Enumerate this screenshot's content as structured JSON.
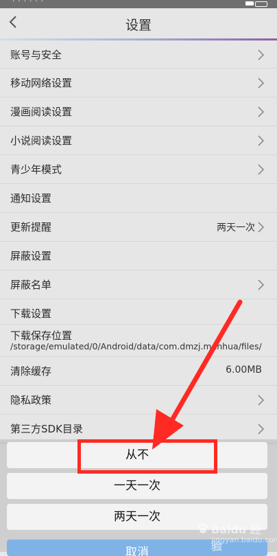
{
  "header": {
    "title": "设置"
  },
  "settings": {
    "account_security": "账号与安全",
    "mobile_network": "移动网络设置",
    "comic_reading": "漫画阅读设置",
    "novel_reading": "小说阅读设置",
    "teen_mode": "青少年模式",
    "notifications": "通知设置",
    "update_reminder": "更新提醒",
    "update_reminder_value": "两天一次",
    "block_settings": "屏蔽设置",
    "block_list": "屏蔽名单",
    "download_settings": "下载设置",
    "download_location": "下载保存位置",
    "download_path": "/storage/emulated/0/Android/data/com.dmzj.manhua/files/",
    "clear_cache": "清除缓存",
    "cache_size": "6.00MB",
    "privacy_policy": "隐私政策",
    "third_party_sdk": "第三方SDK目录"
  },
  "sheet": {
    "option_never": "从不",
    "option_daily": "一天一次",
    "option_two_days": "两天一次",
    "cancel": "取消"
  },
  "watermark": {
    "text": "Baidu 经验",
    "sub": "jingyan.baidu.com"
  },
  "colors": {
    "annotation": "#ff2a24",
    "cancel_button": "#7fb3e6"
  }
}
